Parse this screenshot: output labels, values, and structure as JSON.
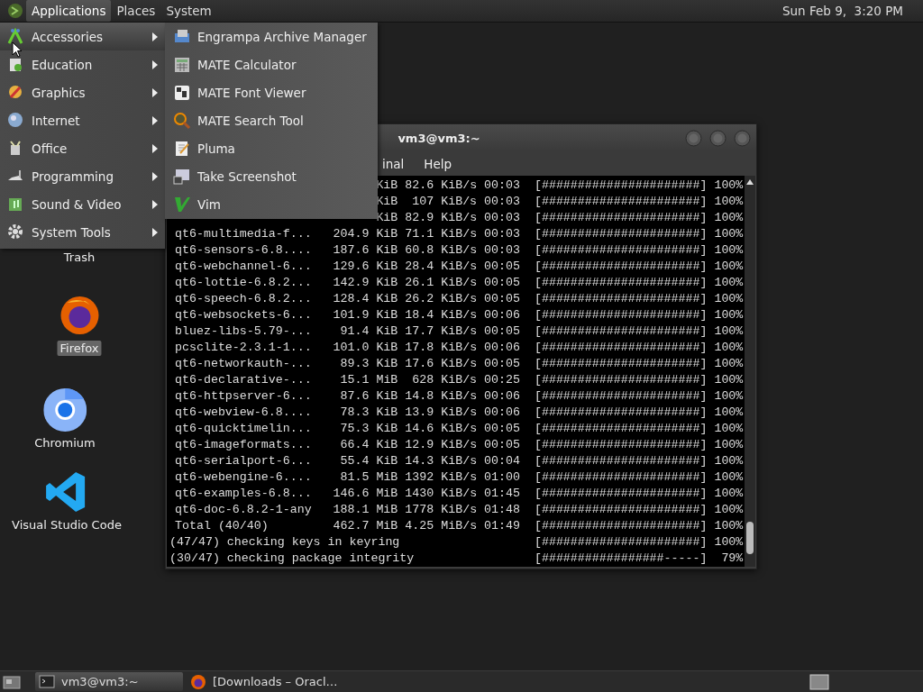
{
  "top_panel": {
    "menus": [
      {
        "label": "Applications",
        "selected": true
      },
      {
        "label": "Places",
        "selected": false
      },
      {
        "label": "System",
        "selected": false
      }
    ],
    "clock": "Sun Feb 9,  3:20 PM"
  },
  "desktop_icons": [
    {
      "label": "Trash",
      "selected": false
    },
    {
      "label": "Firefox",
      "selected": true
    },
    {
      "label": "Chromium",
      "selected": false
    },
    {
      "label": "Visual Studio Code",
      "selected": false
    }
  ],
  "terminal": {
    "title": "vm3@vm3:~",
    "menus": [
      "inal",
      "Help"
    ],
    "lines": [
      {
        "kind": "transfer",
        "size": "KiB",
        "rate": "82.6 KiB/s",
        "eta": "00:03",
        "bar": "[######################]",
        "pct": "100%"
      },
      {
        "kind": "transfer",
        "size": "KiB",
        "rate": "107 KiB/s",
        "eta": "00:03",
        "bar": "[######################]",
        "pct": "100%"
      },
      {
        "kind": "transfer",
        "size": "KiB",
        "rate": "82.9 KiB/s",
        "eta": "00:03",
        "bar": "[######################]",
        "pct": "100%"
      },
      {
        "kind": "transfer",
        "name": "qt6-multimedia-f...",
        "size": "204.9 KiB",
        "rate": "71.1 KiB/s",
        "eta": "00:03",
        "bar": "[######################]",
        "pct": "100%"
      },
      {
        "kind": "transfer",
        "name": "qt6-sensors-6.8....",
        "size": "187.6 KiB",
        "rate": "60.8 KiB/s",
        "eta": "00:03",
        "bar": "[######################]",
        "pct": "100%"
      },
      {
        "kind": "transfer",
        "name": "qt6-webchannel-6...",
        "size": "129.6 KiB",
        "rate": "28.4 KiB/s",
        "eta": "00:05",
        "bar": "[######################]",
        "pct": "100%"
      },
      {
        "kind": "transfer",
        "name": "qt6-lottie-6.8.2...",
        "size": "142.9 KiB",
        "rate": "26.1 KiB/s",
        "eta": "00:05",
        "bar": "[######################]",
        "pct": "100%"
      },
      {
        "kind": "transfer",
        "name": "qt6-speech-6.8.2...",
        "size": "128.4 KiB",
        "rate": "26.2 KiB/s",
        "eta": "00:05",
        "bar": "[######################]",
        "pct": "100%"
      },
      {
        "kind": "transfer",
        "name": "qt6-websockets-6...",
        "size": "101.9 KiB",
        "rate": "18.4 KiB/s",
        "eta": "00:06",
        "bar": "[######################]",
        "pct": "100%"
      },
      {
        "kind": "transfer",
        "name": "bluez-libs-5.79-...",
        "size": "91.4 KiB",
        "rate": "17.7 KiB/s",
        "eta": "00:05",
        "bar": "[######################]",
        "pct": "100%"
      },
      {
        "kind": "transfer",
        "name": "pcsclite-2.3.1-1...",
        "size": "101.0 KiB",
        "rate": "17.8 KiB/s",
        "eta": "00:06",
        "bar": "[######################]",
        "pct": "100%"
      },
      {
        "kind": "transfer",
        "name": "qt6-networkauth-...",
        "size": "89.3 KiB",
        "rate": "17.6 KiB/s",
        "eta": "00:05",
        "bar": "[######################]",
        "pct": "100%"
      },
      {
        "kind": "transfer",
        "name": "qt6-declarative-...",
        "size": "15.1 MiB",
        "rate": "628 KiB/s",
        "eta": "00:25",
        "bar": "[######################]",
        "pct": "100%"
      },
      {
        "kind": "transfer",
        "name": "qt6-httpserver-6...",
        "size": "87.6 KiB",
        "rate": "14.8 KiB/s",
        "eta": "00:06",
        "bar": "[######################]",
        "pct": "100%"
      },
      {
        "kind": "transfer",
        "name": "qt6-webview-6.8....",
        "size": "78.3 KiB",
        "rate": "13.9 KiB/s",
        "eta": "00:06",
        "bar": "[######################]",
        "pct": "100%"
      },
      {
        "kind": "transfer",
        "name": "qt6-quicktimelin...",
        "size": "75.3 KiB",
        "rate": "14.6 KiB/s",
        "eta": "00:05",
        "bar": "[######################]",
        "pct": "100%"
      },
      {
        "kind": "transfer",
        "name": "qt6-imageformats...",
        "size": "66.4 KiB",
        "rate": "12.9 KiB/s",
        "eta": "00:05",
        "bar": "[######################]",
        "pct": "100%"
      },
      {
        "kind": "transfer",
        "name": "qt6-serialport-6...",
        "size": "55.4 KiB",
        "rate": "14.3 KiB/s",
        "eta": "00:04",
        "bar": "[######################]",
        "pct": "100%"
      },
      {
        "kind": "transfer",
        "name": "qt6-webengine-6....",
        "size": "81.5 MiB",
        "rate": "1392 KiB/s",
        "eta": "01:00",
        "bar": "[######################]",
        "pct": "100%"
      },
      {
        "kind": "transfer",
        "name": "qt6-examples-6.8...",
        "size": "146.6 MiB",
        "rate": "1430 KiB/s",
        "eta": "01:45",
        "bar": "[######################]",
        "pct": "100%"
      },
      {
        "kind": "transfer",
        "name": "qt6-doc-6.8.2-1-any",
        "size": "188.1 MiB",
        "rate": "1778 KiB/s",
        "eta": "01:48",
        "bar": "[######################]",
        "pct": "100%"
      },
      {
        "kind": "transfer",
        "name": "Total (40/40)",
        "size": "462.7 MiB",
        "rate": "4.25 MiB/s",
        "eta": "01:49",
        "bar": "[######################]",
        "pct": "100%"
      },
      {
        "kind": "check",
        "name": "(47/47) checking keys in keyring",
        "bar": "[######################]",
        "pct": "100%"
      },
      {
        "kind": "check",
        "name": "(30/47) checking package integrity",
        "bar": "[#################-----]",
        "pct": "79%"
      }
    ]
  },
  "applications_menu": {
    "categories": [
      {
        "label": "Accessories",
        "selected": true
      },
      {
        "label": "Education",
        "selected": false
      },
      {
        "label": "Graphics",
        "selected": false
      },
      {
        "label": "Internet",
        "selected": false
      },
      {
        "label": "Office",
        "selected": false
      },
      {
        "label": "Programming",
        "selected": false
      },
      {
        "label": "Sound & Video",
        "selected": false
      },
      {
        "label": "System Tools",
        "selected": false
      }
    ],
    "submenu": [
      "Engrampa Archive Manager",
      "MATE Calculator",
      "MATE Font Viewer",
      "MATE Search Tool",
      "Pluma",
      "Take Screenshot",
      "Vim"
    ]
  },
  "bottom_panel": {
    "tasks": [
      {
        "label": "vm3@vm3:~",
        "selected": true
      },
      {
        "label": "[Downloads – Oracl…",
        "selected": false
      }
    ]
  }
}
